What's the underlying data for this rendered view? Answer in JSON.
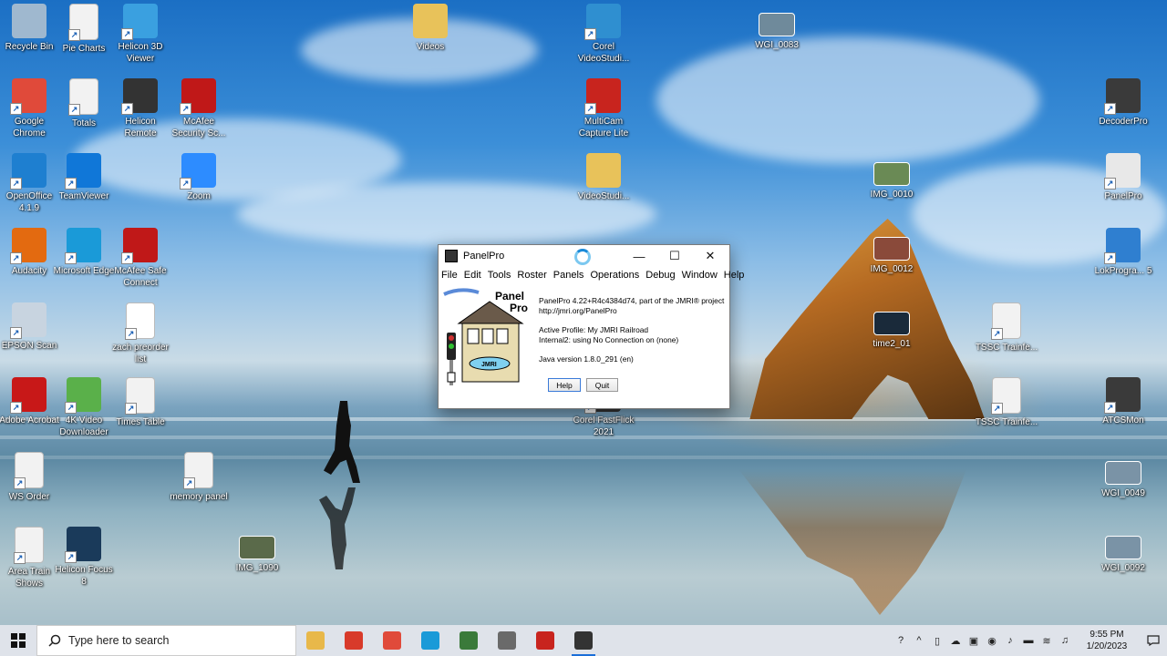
{
  "desktop": {
    "icons": [
      {
        "label": "Recycle Bin",
        "icon": "recycle-bin-icon",
        "color": "#9fb8cf"
      },
      {
        "label": "Pie Charts",
        "icon": "document-icon",
        "color": "#f2f2f2"
      },
      {
        "label": "Helicon 3D Viewer",
        "icon": "helicon-3d-icon",
        "color": "#3aa0e0"
      },
      {
        "label": "Videos",
        "icon": "folder-icon",
        "color": "#e8c25a"
      },
      {
        "label": "Corel VideoStudi...",
        "icon": "corel-v-icon",
        "color": "#2f8fd0"
      },
      {
        "label": "WGI_0083",
        "icon": "photo-icon",
        "color": "#6f8a9b"
      },
      {
        "label": "Google Chrome",
        "icon": "chrome-icon",
        "color": "#e04a3a"
      },
      {
        "label": "Totals",
        "icon": "document-icon",
        "color": "#f2f2f2"
      },
      {
        "label": "Helicon Remote",
        "icon": "camera-icon",
        "color": "#333333"
      },
      {
        "label": "McAfee Security Sc...",
        "icon": "mcafee-icon",
        "color": "#c01818"
      },
      {
        "label": "MultiCam Capture Lite",
        "icon": "multicam-icon",
        "color": "#c8241e"
      },
      {
        "label": "DecoderPro",
        "icon": "decoderpro-icon",
        "color": "#3a3a3a"
      },
      {
        "label": "OpenOffice 4.1.9",
        "icon": "openoffice-icon",
        "color": "#1e7fd0"
      },
      {
        "label": "TeamViewer",
        "icon": "teamviewer-icon",
        "color": "#1077d8"
      },
      {
        "label": "Zoom",
        "icon": "zoom-icon",
        "color": "#2d8cff"
      },
      {
        "label": "VideoStudi...",
        "icon": "folder-icon",
        "color": "#e8c25a"
      },
      {
        "label": "IMG_0010",
        "icon": "photo-icon",
        "color": "#6a8a55"
      },
      {
        "label": "PanelPro",
        "icon": "panelpro-icon",
        "color": "#e8e8e8"
      },
      {
        "label": "Audacity",
        "icon": "audacity-icon",
        "color": "#e36a10"
      },
      {
        "label": "Microsoft Edge",
        "icon": "edge-icon",
        "color": "#1a9ad8"
      },
      {
        "label": "McAfee Safe Connect",
        "icon": "mcafee-safe-icon",
        "color": "#c01818"
      },
      {
        "label": "IMG_0012",
        "icon": "photo-icon",
        "color": "#8a4a3a"
      },
      {
        "label": "LokProgra... 5",
        "icon": "esu-icon",
        "color": "#2f7fd0"
      },
      {
        "label": "EPSON Scan",
        "icon": "scanner-icon",
        "color": "#c8d4e0"
      },
      {
        "label": "zach preorder list",
        "icon": "pdf-icon",
        "color": "#ffffff"
      },
      {
        "label": "time2_01",
        "icon": "video-thumb-icon",
        "color": "#1a2a3a"
      },
      {
        "label": "TSSC Trainfe...",
        "icon": "document-icon",
        "color": "#f2f2f2"
      },
      {
        "label": "Adobe Acrobat",
        "icon": "acrobat-icon",
        "color": "#c81818"
      },
      {
        "label": "4K Video Downloader",
        "icon": "download-icon",
        "color": "#5ab04a"
      },
      {
        "label": "Times Table",
        "icon": "spreadsheet-icon",
        "color": "#f2f2f2"
      },
      {
        "label": "Corel FastFlick 2021",
        "icon": "corel-icon",
        "color": "#333333"
      },
      {
        "label": "TSSC Trainfe...",
        "icon": "document-icon",
        "color": "#f2f2f2"
      },
      {
        "label": "ATCSMon",
        "icon": "signal-icon",
        "color": "#3a3a3a"
      },
      {
        "label": "WS Order",
        "icon": "document-icon",
        "color": "#f2f2f2"
      },
      {
        "label": "memory panel",
        "icon": "document-icon",
        "color": "#f2f2f2"
      },
      {
        "label": "WGI_0049",
        "icon": "photo-icon",
        "color": "#7a93a6"
      },
      {
        "label": "Area Train Shows",
        "icon": "document-icon",
        "color": "#f2f2f2"
      },
      {
        "label": "Helicon Focus 8",
        "icon": "helicon-focus-icon",
        "color": "#1a3a5a"
      },
      {
        "label": "IMG_1090",
        "icon": "photo-icon",
        "color": "#5a6a4a"
      },
      {
        "label": "WGI_0092",
        "icon": "photo-icon",
        "color": "#7a93a6"
      }
    ]
  },
  "window": {
    "title": "PanelPro",
    "controls": {
      "minimize": "—",
      "maximize": "☐",
      "close": "✕"
    },
    "menu": [
      "File",
      "Edit",
      "Tools",
      "Roster",
      "Panels",
      "Operations",
      "Debug",
      "Window",
      "Help"
    ],
    "logo_text": "Panel Pro",
    "logo_sign": "JMRI",
    "info": {
      "line1": "PanelPro 4.22+R4c4384d74, part of the JMRI® project",
      "line2": "http://jmri.org/PanelPro",
      "line3": "Active Profile: My JMRI Railroad",
      "line4": "Internal2: using No Connection on (none)",
      "line5": "Java version 1.8.0_291 (en)"
    },
    "buttons": {
      "help": "Help",
      "quit": "Quit"
    }
  },
  "taskbar": {
    "search_placeholder": "Type here to search",
    "apps": [
      {
        "icon": "file-explorer-icon",
        "color": "#e8b84a"
      },
      {
        "icon": "paint-icon",
        "color": "#d83a2a"
      },
      {
        "icon": "chrome-icon",
        "color": "#e04a3a"
      },
      {
        "icon": "edge-wave-icon",
        "color": "#1a9ad8"
      },
      {
        "icon": "signal-icon",
        "color": "#3a7a3a"
      },
      {
        "icon": "calculator-icon",
        "color": "#6a6a6a"
      },
      {
        "icon": "multicam-icon",
        "color": "#c8241e"
      },
      {
        "icon": "panelpro-icon",
        "color": "#333333"
      }
    ],
    "tray_icons": [
      "help-icon",
      "chevron-up-icon",
      "device-icon",
      "cloud-icon",
      "security-icon",
      "camera-icon",
      "mic-icon",
      "battery-icon",
      "wifi-icon",
      "volume-icon"
    ],
    "time": "9:55 PM",
    "date": "1/20/2023",
    "notification_icon": "notification-icon"
  }
}
